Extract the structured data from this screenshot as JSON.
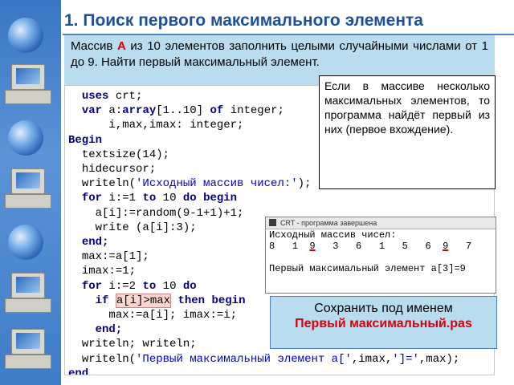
{
  "title": "1. Поиск первого максимального элемента",
  "task": {
    "before": "Массив ",
    "accent": "А",
    "after": " из 10 элементов заполнить целыми случайными числами от 1 до 9. Найти первый максимальный элемент."
  },
  "callout": "Если в массиве несколько максимальных элементов, то программа найдёт первый из них (первое вхождение).",
  "code": {
    "l1a": "uses",
    "l1b": " crt;",
    "l2a": "var",
    "l2b": " a:",
    "l2c": "array",
    "l2d": "[1..10] ",
    "l2e": "of",
    "l2f": " integer;",
    "l3": "i,max,imax: integer;",
    "l4": "Begin",
    "l5": "textsize(14);",
    "l6": "hidecursor;",
    "l7a": "writeln(",
    "l7b": "'Исходный массив чисел:'",
    "l7c": ");",
    "l8a": "for",
    "l8b": " i:=1 ",
    "l8c": "to",
    "l8d": " 10 ",
    "l8e": "do begin",
    "l9": "a[i]:=random(9-1+1)+1;",
    "l10": "write (a[i]:3);",
    "l11": "end;",
    "l12": "max:=a[1];",
    "l13": "imax:=1;",
    "l14a": "for",
    "l14b": " i:=2 ",
    "l14c": "to",
    "l14d": " 10 ",
    "l14e": "do",
    "l15a": "if",
    "l15b": "a[i]>max",
    "l15c": "then begin",
    "l16": "max:=a[i]; imax:=i;",
    "l17": "end;",
    "l18": "writeln; writeln;",
    "l19a": "writeln(",
    "l19b": "'Первый максимальный элемент a['",
    "l19c": ",imax,",
    "l19d": "']='",
    "l19e": ",max);",
    "l20": "end."
  },
  "console": {
    "window_title": "CRT - программа завершена",
    "line1": "Исходный массив чисел:",
    "numbers": [
      "8",
      "1",
      "9",
      "3",
      "6",
      "1",
      "5",
      "6",
      "9",
      "7"
    ],
    "result": "Первый максимальный элемент a[3]=9"
  },
  "save": {
    "label": "Сохранить под именем",
    "filename": "Первый максимальный.pas"
  },
  "icons": [
    "globe-icon",
    "computer-icon"
  ],
  "colors": {
    "accent": "#d8000a",
    "title": "#1f4f9a",
    "task_bg": "#b9dcef",
    "sidebar": "#3a76c4"
  }
}
